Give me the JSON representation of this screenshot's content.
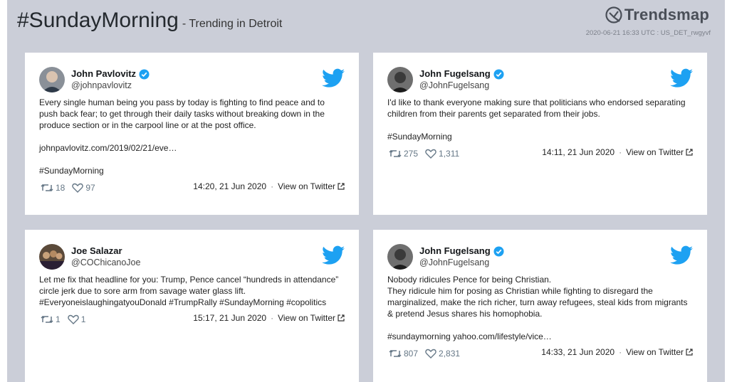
{
  "header": {
    "hashtag": "#SundayMorning",
    "subtitle": "- Trending in Detroit",
    "brand": "Trendsmap",
    "meta": "2020-06-21 16:33 UTC : US_DET_rwgyvf"
  },
  "colors": {
    "background": "#cbced8",
    "twitter_blue": "#1da1f2",
    "verified_blue": "#1da1f2"
  },
  "tweets": [
    {
      "name": "John Pavlovitz",
      "handle": "@johnpavlovitz",
      "verified": true,
      "text": "Every single human being you pass by today is fighting to find peace and to push back fear; to get through their daily tasks without breaking down in the produce section or in the carpool line or at the post office.\n\njohnpavlovitz.com/2019/02/21/eve…\n\n#SundayMorning",
      "retweets": "18",
      "likes": "97",
      "time": "14:20, 21 Jun 2020",
      "view": "View on Twitter"
    },
    {
      "name": "John Fugelsang",
      "handle": "@JohnFugelsang",
      "verified": true,
      "text": "I'd like to thank everyone making sure that politicians who endorsed separating children from their parents get separated from their jobs.\n\n#SundayMorning",
      "retweets": "275",
      "likes": "1,311",
      "time": "14:11, 21 Jun 2020",
      "view": "View on Twitter"
    },
    {
      "name": "Joe Salazar",
      "handle": "@COChicanoJoe",
      "verified": false,
      "text": "Let me fix that headline for you: Trump, Pence cancel “hundreds in attendance” circle jerk due to sore arm from savage water glass lift.\n#EveryoneislaughingatyouDonald #TrumpRally #SundayMorning #copolitics",
      "retweets": "1",
      "likes": "1",
      "time": "15:17, 21 Jun 2020",
      "view": "View on Twitter"
    },
    {
      "name": "John Fugelsang",
      "handle": "@JohnFugelsang",
      "verified": true,
      "text": "Nobody ridicules Pence for being Christian.\nThey ridicule him for posing as Christian while fighting to disregard the marginalized, make the rich richer, turn away refugees, steal kids from migrants & pretend Jesus shares his homophobia.\n\n#sundaymorning yahoo.com/lifestyle/vice…",
      "retweets": "807",
      "likes": "2,831",
      "time": "14:33, 21 Jun 2020",
      "view": "View on Twitter"
    }
  ]
}
